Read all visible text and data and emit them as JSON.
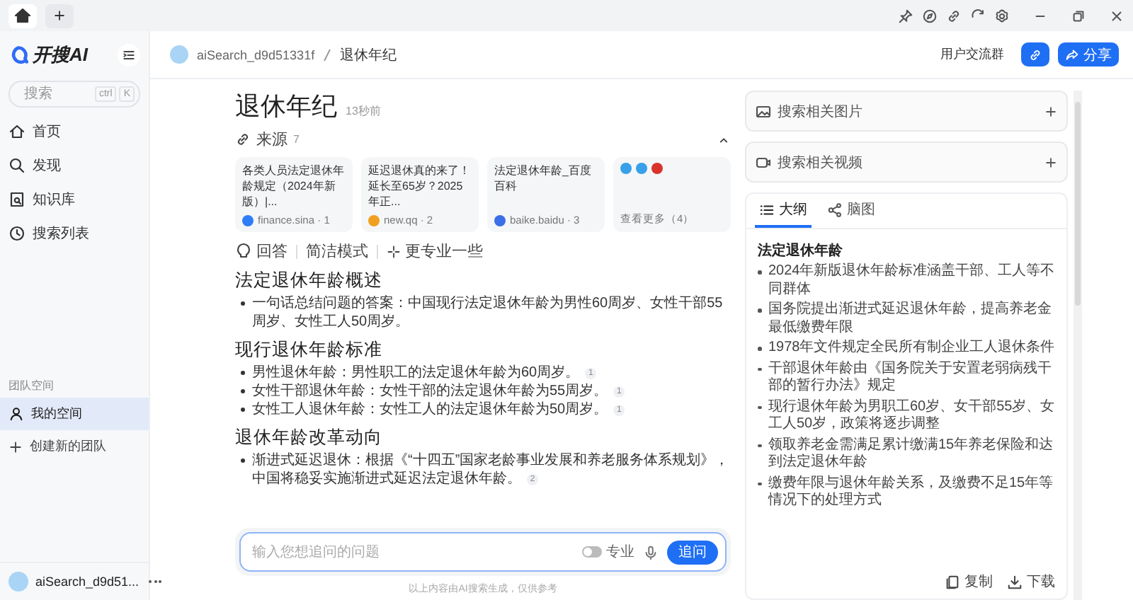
{
  "sidebar": {
    "logo": "开搜AI",
    "search": {
      "placeholder": "搜索",
      "keys": [
        "ctrl",
        "K"
      ]
    },
    "nav": [
      {
        "label": "首页",
        "kind": "home"
      },
      {
        "label": "发现",
        "kind": "discover"
      },
      {
        "label": "知识库",
        "kind": "library"
      },
      {
        "label": "搜索列表",
        "kind": "history"
      }
    ],
    "team": {
      "title": "团队空间",
      "items": [
        {
          "label": "我的空间",
          "kind": "space",
          "selected": true
        },
        {
          "label": "创建新的团队",
          "kind": "create",
          "selected": false
        }
      ]
    },
    "user": {
      "name": "aiSearch_d9d51..."
    }
  },
  "header": {
    "breadcrumb": [
      "aiSearch_d9d51331f",
      "退休年纪"
    ],
    "community": "用户交流群",
    "share": "分享"
  },
  "article": {
    "title": "退休年纪",
    "time": "13秒前",
    "sources": {
      "label": "来源",
      "count": "7",
      "expanded": true,
      "items": [
        {
          "title": "各类人员法定退休年龄规定（2024年新版）|...",
          "site": "finance.sina · 1",
          "color": "#2f7df6"
        },
        {
          "title": "延迟退休真的来了！延长至65岁？2025年正...",
          "site": "new.qq · 2",
          "color": "#f0a020"
        },
        {
          "title": "法定退休年龄_百度百科",
          "site": "baike.baidu · 3",
          "color": "#3b6ee8"
        }
      ],
      "more": {
        "label": "查看更多（4）",
        "icons": [
          {
            "color": "#37a0e8"
          },
          {
            "color": "#37a0e8"
          },
          {
            "color": "#d9342b"
          }
        ]
      }
    },
    "modes": [
      {
        "label": "回答",
        "kind": "answer"
      },
      {
        "label": "简洁模式",
        "kind": "plain"
      },
      {
        "label": "更专业一些",
        "kind": "pro"
      }
    ],
    "sections": [
      {
        "heading": "法定退休年龄概述",
        "bullets": [
          {
            "text": "一句话总结问题的答案：中国现行法定退休年龄为男性60周岁、女性干部55周岁、女性工人50周岁。"
          }
        ]
      },
      {
        "heading": "现行退休年龄标准",
        "bullets": [
          {
            "text": "男性退休年龄：男性职工的法定退休年龄为60周岁。",
            "cite": "1"
          },
          {
            "text": "女性干部退休年龄：女性干部的法定退休年龄为55周岁。",
            "cite": "1"
          },
          {
            "text": "女性工人退休年龄：女性工人的法定退休年龄为50周岁。",
            "cite": "1"
          }
        ]
      },
      {
        "heading": "退休年龄改革动向",
        "bullets": [
          {
            "text": "渐进式延迟退休：根据《“十四五”国家老龄事业发展和养老服务体系规划》，中国将稳妥实施渐进式延迟法定退休年龄。",
            "cite": "2"
          }
        ]
      }
    ]
  },
  "ask": {
    "placeholder": "输入您想追问的问题",
    "pro": {
      "label": "专业",
      "on": false
    },
    "submit": "追问",
    "note": "以上内容由AI搜索生成，仅供参考"
  },
  "panel": {
    "cards": [
      {
        "label": "搜索相关图片",
        "kind": "images"
      },
      {
        "label": "搜索相关视频",
        "kind": "videos"
      }
    ],
    "tabs": [
      {
        "label": "大纲",
        "kind": "outline",
        "selected": true
      },
      {
        "label": "脑图",
        "kind": "mindmap",
        "selected": false
      }
    ],
    "outline": {
      "title": "法定退休年龄",
      "items": [
        "2024年新版退休年龄标准涵盖干部、工人等不同群体",
        "国务院提出渐进式延迟退休年龄，提高养老金最低缴费年限",
        "1978年文件规定全民所有制企业工人退休条件",
        "干部退休年龄由《国务院关于安置老弱病残干部的暂行办法》规定",
        "现行退休年龄为男职工60岁、女干部55岁、女工人50岁，政策将逐步调整",
        "领取养老金需满足累计缴满15年养老保险和达到法定退休年龄",
        "缴费年限与退休年龄关系，及缴费不足15年等情况下的处理方式"
      ]
    },
    "actions": [
      {
        "label": "复制",
        "kind": "copy"
      },
      {
        "label": "下载",
        "kind": "download"
      }
    ]
  }
}
